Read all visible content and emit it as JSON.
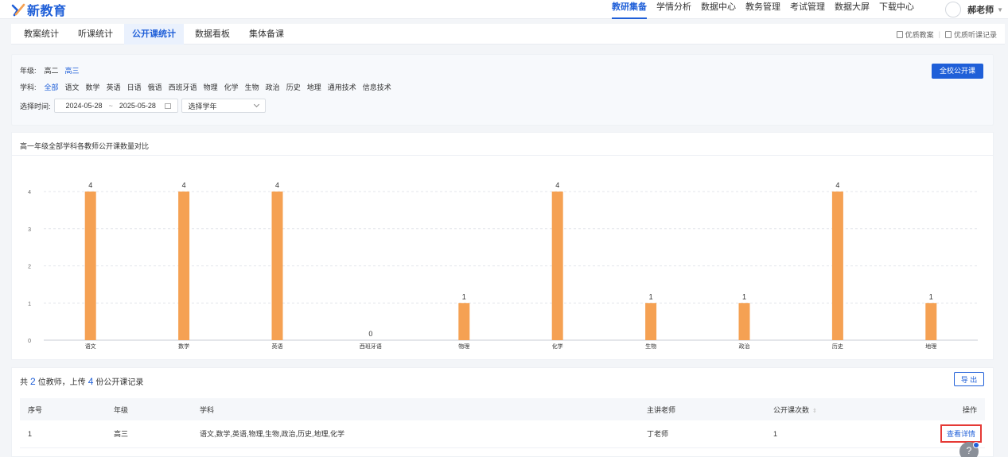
{
  "app": {
    "logo_text": "新教育"
  },
  "topnav": {
    "items": [
      {
        "label": "教研集备",
        "active": true
      },
      {
        "label": "学情分析"
      },
      {
        "label": "数据中心"
      },
      {
        "label": "教务管理"
      },
      {
        "label": "考试管理"
      },
      {
        "label": "数据大屏"
      },
      {
        "label": "下载中心"
      }
    ],
    "user_name": "郝老师"
  },
  "tabs": {
    "items": [
      {
        "label": "教案统计"
      },
      {
        "label": "听课统计"
      },
      {
        "label": "公开课统计",
        "active": true
      },
      {
        "label": "数据看板"
      },
      {
        "label": "集体备课"
      }
    ],
    "right_links": [
      "优质教案",
      "优质听课记录"
    ]
  },
  "filter": {
    "grade_label": "年级:",
    "grades": [
      {
        "label": "高二"
      },
      {
        "label": "高三",
        "active": true
      }
    ],
    "subject_label": "学科:",
    "subjects": [
      {
        "label": "全部",
        "active": true
      },
      {
        "label": "语文"
      },
      {
        "label": "数学"
      },
      {
        "label": "英语"
      },
      {
        "label": "日语"
      },
      {
        "label": "俄语"
      },
      {
        "label": "西班牙语"
      },
      {
        "label": "物理"
      },
      {
        "label": "化学"
      },
      {
        "label": "生物"
      },
      {
        "label": "政治"
      },
      {
        "label": "历史"
      },
      {
        "label": "地理"
      },
      {
        "label": "通用技术"
      },
      {
        "label": "信息技术"
      }
    ],
    "time_label": "选择时间:",
    "date_start": "2024-05-28",
    "date_sep": "~",
    "date_end": "2025-05-28",
    "year_select_placeholder": "选择学年",
    "school_button": "全校公开课"
  },
  "chart_data": {
    "type": "bar",
    "title": "高一年级全部学科各教师公开课数量对比",
    "categories": [
      "语文",
      "数学",
      "英语",
      "西班牙语",
      "物理",
      "化学",
      "生物",
      "政治",
      "历史",
      "地理"
    ],
    "values": [
      4,
      4,
      4,
      0,
      1,
      4,
      1,
      1,
      4,
      1
    ],
    "ylim": [
      0,
      4
    ],
    "yticks": [
      0,
      1,
      2,
      3,
      4
    ],
    "grid": true,
    "bar_color": "#f5a153",
    "data_labels": true
  },
  "summary": {
    "prefix": "共",
    "teachers": "2",
    "mid": "位教师，上传",
    "records": "4",
    "suffix": "份公开课记录",
    "export_label": "导 出"
  },
  "table": {
    "headers": [
      "序号",
      "年级",
      "学科",
      "主讲老师",
      "公开课次数",
      "操作"
    ],
    "rows": [
      {
        "index": "1",
        "grade": "高三",
        "subjects": "语文,数学,英语,物理,生物,政治,历史,地理,化学",
        "teacher": "丁老师",
        "count": "1",
        "action": "查看详情"
      }
    ]
  },
  "colors": {
    "primary": "#1f5fd8",
    "bar": "#f5a153",
    "highlight": "#e53935"
  }
}
